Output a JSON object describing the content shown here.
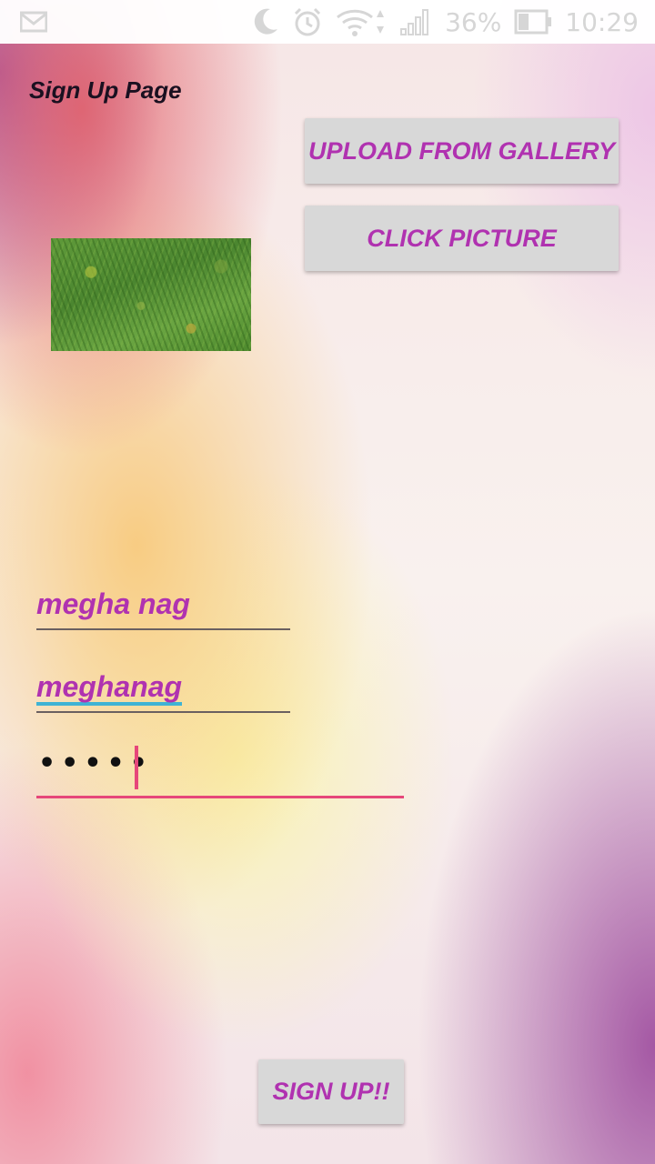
{
  "status_bar": {
    "battery_percent": "36%",
    "time": "10:29",
    "icons": [
      "gmail-icon",
      "moon-icon",
      "alarm-icon",
      "wifi-icon",
      "signal-icon",
      "battery-icon"
    ]
  },
  "page": {
    "title": "Sign Up Page"
  },
  "buttons": {
    "upload_label": "UPLOAD FROM GALLERY",
    "click_label": "CLICK PICTURE",
    "signup_label": "SIGN UP!!"
  },
  "form": {
    "name_value": "megha nag",
    "username_value": "meghanag",
    "password_masked": "•••••"
  },
  "colors": {
    "accent": "#b032b0",
    "focus_underline": "#e6477a",
    "spellcheck_underline": "#3fb3d4",
    "button_bg": "#d8d8d8"
  }
}
